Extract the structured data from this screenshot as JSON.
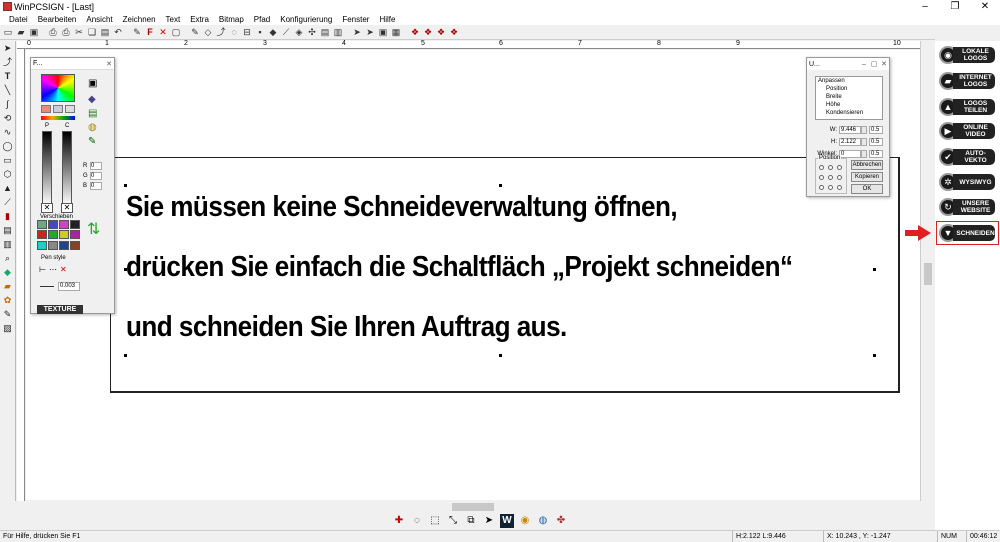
{
  "window": {
    "title": "WinPCSIGN - [Last]",
    "controls": [
      "–",
      "❐",
      "✕"
    ]
  },
  "menu": [
    "Datei",
    "Bearbeiten",
    "Ansicht",
    "Zeichnen",
    "Text",
    "Extra",
    "Bitmap",
    "Pfad",
    "Konfigurierung",
    "Fenster",
    "Hilfe"
  ],
  "ruler": {
    "top_numbers": [
      "0",
      "1",
      "2",
      "3",
      "4",
      "5",
      "6",
      "7",
      "8",
      "9",
      "10"
    ]
  },
  "canvas": {
    "lines": [
      "Sie müssen keine Schneideverwaltung öffnen,",
      "drücken Sie einfach die Schaltfläch „Projekt schneiden“",
      "und schneiden Sie Ihren Auftrag aus."
    ]
  },
  "color_palette": {
    "title": "F...",
    "rgb": {
      "r_label": "R",
      "g_label": "G",
      "b_label": "B",
      "r": "0",
      "g": "0",
      "b": "0"
    },
    "slider_labels": [
      "P",
      "C"
    ],
    "shift_label": "Verschieben",
    "pen_style_label": "Pen style",
    "pen_width": "0.003",
    "texture_label": "TEXTURE"
  },
  "size_dialog": {
    "title": "U...",
    "tree": [
      "Anpassen",
      "Position",
      "Breite",
      "Höhe",
      "Kondensieren"
    ],
    "w_label": "W:",
    "w_value": "9.446",
    "w_step": "0.5",
    "h_label": "H:",
    "h_value": "2.122",
    "h_step": "0.5",
    "angle_label": "Winkel:",
    "angle_value": "0",
    "angle_step": "0.5",
    "position_label": "Position",
    "cancel_label": "Abbrechen",
    "copy_label": "Kopieren",
    "ok_label": "OK"
  },
  "right_panel": [
    {
      "label": "LOKALE LOGOS",
      "icon": "logo-icon"
    },
    {
      "label": "INTERNET LOGOS",
      "icon": "internet-icon"
    },
    {
      "label": "LOGOS TEILEN",
      "icon": "share-icon"
    },
    {
      "label": "ONLINE VIDEO",
      "icon": "video-icon"
    },
    {
      "label": "AUTO-VEKTO",
      "icon": "vector-icon"
    },
    {
      "label": "WYSIWYG",
      "icon": "wysiwyg-icon"
    },
    {
      "label": "UNSERE WEBSITE",
      "icon": "website-icon"
    },
    {
      "label": "SCHNEIDEN",
      "icon": "cut-icon"
    }
  ],
  "status": {
    "help": "Für Hilfe, drücken Sie F1",
    "size": "H:2.122   L:9.446",
    "coords": "X: 10.243 , Y: -1.247",
    "num": "NUM",
    "time": "00:46:12"
  },
  "colors": {
    "accent_red": "#e02020"
  }
}
